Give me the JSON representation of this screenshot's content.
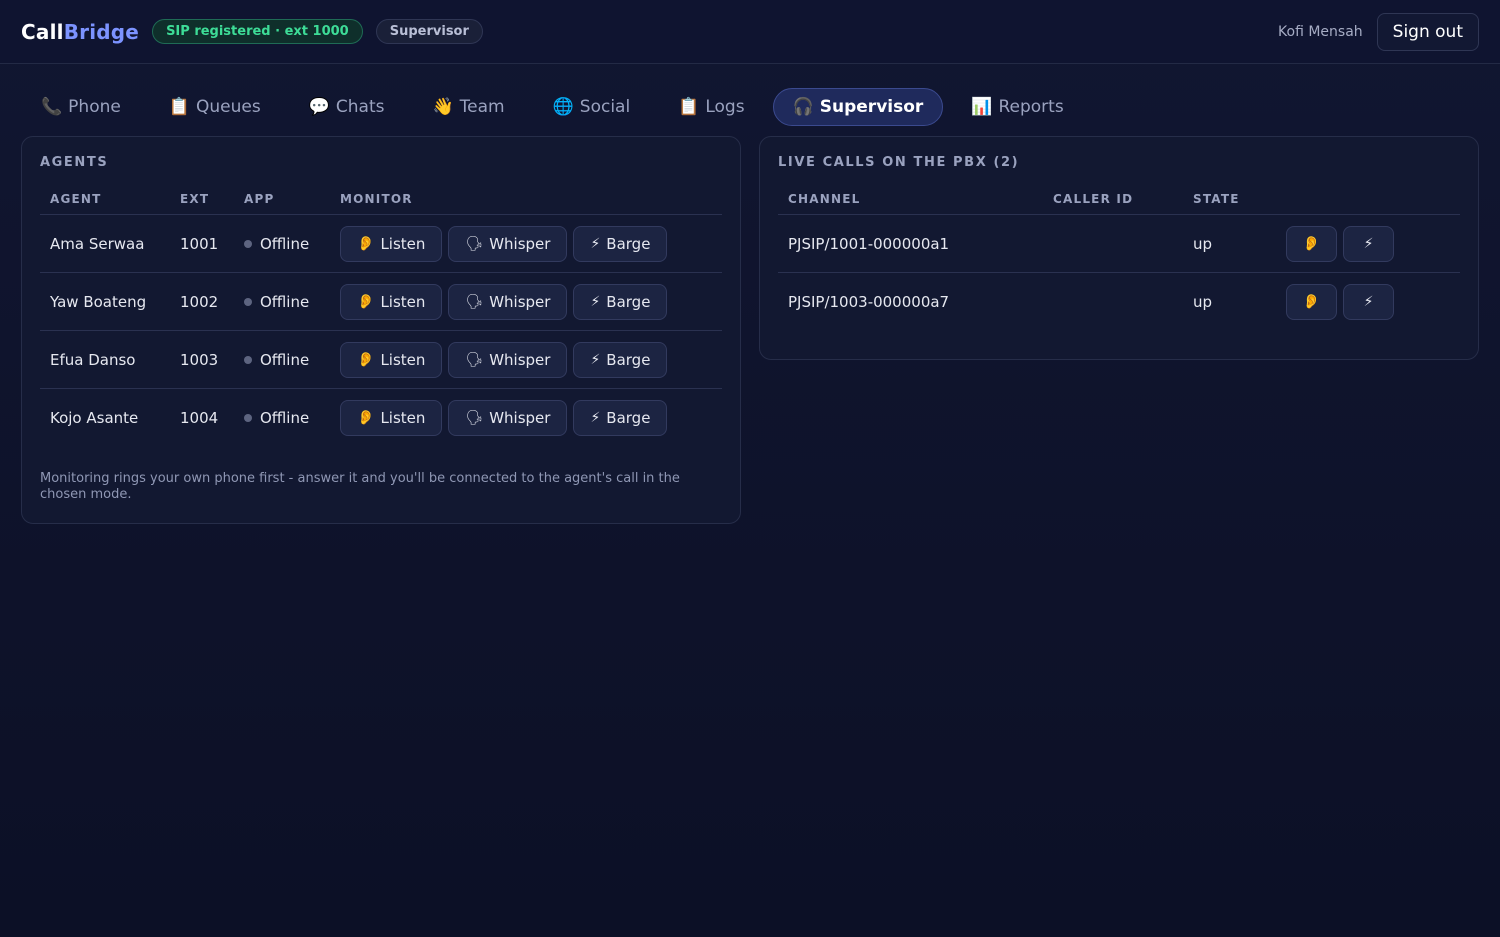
{
  "header": {
    "brand_a": "Call",
    "brand_b": "Bridge",
    "sip_status": "SIP registered · ext 1000",
    "role": "Supervisor",
    "user": "Kofi Mensah",
    "signout": "Sign out"
  },
  "tabs": [
    {
      "icon": "📞",
      "label": "Phone"
    },
    {
      "icon": "📋",
      "label": "Queues"
    },
    {
      "icon": "💬",
      "label": "Chats"
    },
    {
      "icon": "👋",
      "label": "Team"
    },
    {
      "icon": "🌐",
      "label": "Social"
    },
    {
      "icon": "📋",
      "label": "Logs"
    },
    {
      "icon": "🎧",
      "label": "Supervisor"
    },
    {
      "icon": "📊",
      "label": "Reports"
    }
  ],
  "agents_panel": {
    "title": "AGENTS",
    "headers": {
      "agent": "AGENT",
      "ext": "EXT",
      "app": "APP",
      "monitor": "MONITOR"
    },
    "buttons": {
      "listen_icon": "👂",
      "listen": "Listen",
      "whisper_icon": "🗣",
      "whisper": "Whisper",
      "barge_icon": "⚡",
      "barge": "Barge"
    },
    "rows": [
      {
        "name": "Ama Serwaa",
        "ext": "1001",
        "status": "Offline"
      },
      {
        "name": "Yaw Boateng",
        "ext": "1002",
        "status": "Offline"
      },
      {
        "name": "Efua Danso",
        "ext": "1003",
        "status": "Offline"
      },
      {
        "name": "Kojo Asante",
        "ext": "1004",
        "status": "Offline"
      }
    ],
    "note": "Monitoring rings your own phone first - answer it and you'll be connected to the agent's call in the chosen mode."
  },
  "calls_panel": {
    "title": "LIVE CALLS ON THE PBX (2)",
    "headers": {
      "channel": "CHANNEL",
      "caller_id": "CALLER ID",
      "state": "STATE"
    },
    "listen_icon": "👂",
    "barge_icon": "⚡",
    "rows": [
      {
        "channel": "PJSIP/1001-000000a1",
        "caller_id": "",
        "state": "up"
      },
      {
        "channel": "PJSIP/1003-000000a7",
        "caller_id": "",
        "state": "up"
      }
    ]
  }
}
